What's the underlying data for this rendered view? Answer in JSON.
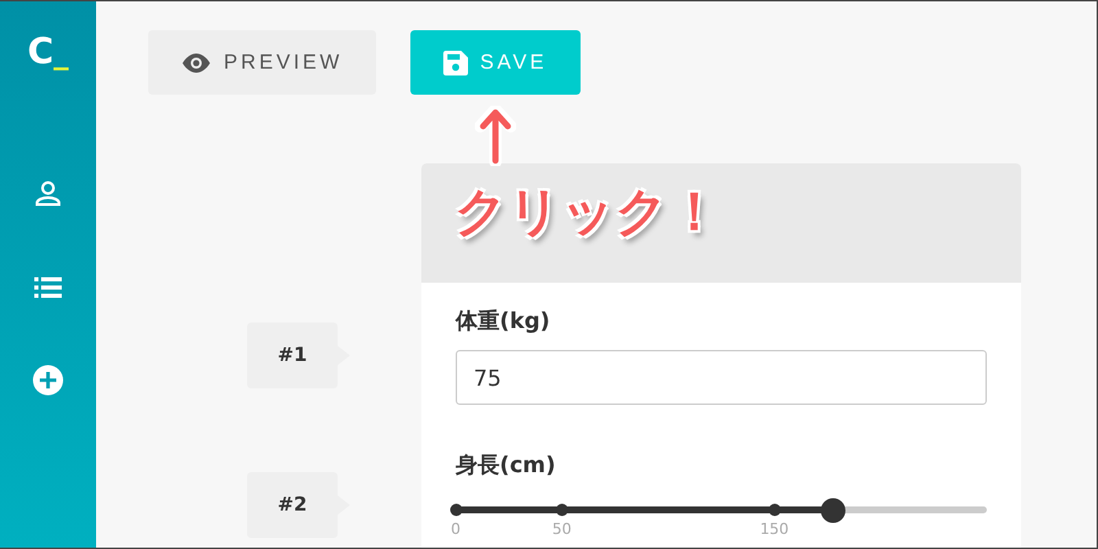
{
  "sidebar": {
    "logo": {
      "letter": "C",
      "cursor": "_"
    },
    "items": [
      {
        "kind": "person"
      },
      {
        "kind": "list"
      },
      {
        "kind": "add"
      }
    ]
  },
  "toolbar": {
    "buttons": [
      {
        "kind": "preview",
        "label": "PREVIEW"
      },
      {
        "kind": "save",
        "label": "SAVE"
      }
    ]
  },
  "annotation": {
    "callout": "クリック！"
  },
  "steps": [
    "#1",
    "#2"
  ],
  "form": {
    "fields": [
      {
        "kind": "text",
        "label": "体重(kg)",
        "value": "75"
      },
      {
        "kind": "slider",
        "label": "身長(cm)",
        "level": 0.71,
        "ticks": [
          {
            "label": "0",
            "level": 0
          },
          {
            "label": "50",
            "level": 0.2
          },
          {
            "label": "150",
            "level": 0.6
          }
        ]
      }
    ]
  }
}
